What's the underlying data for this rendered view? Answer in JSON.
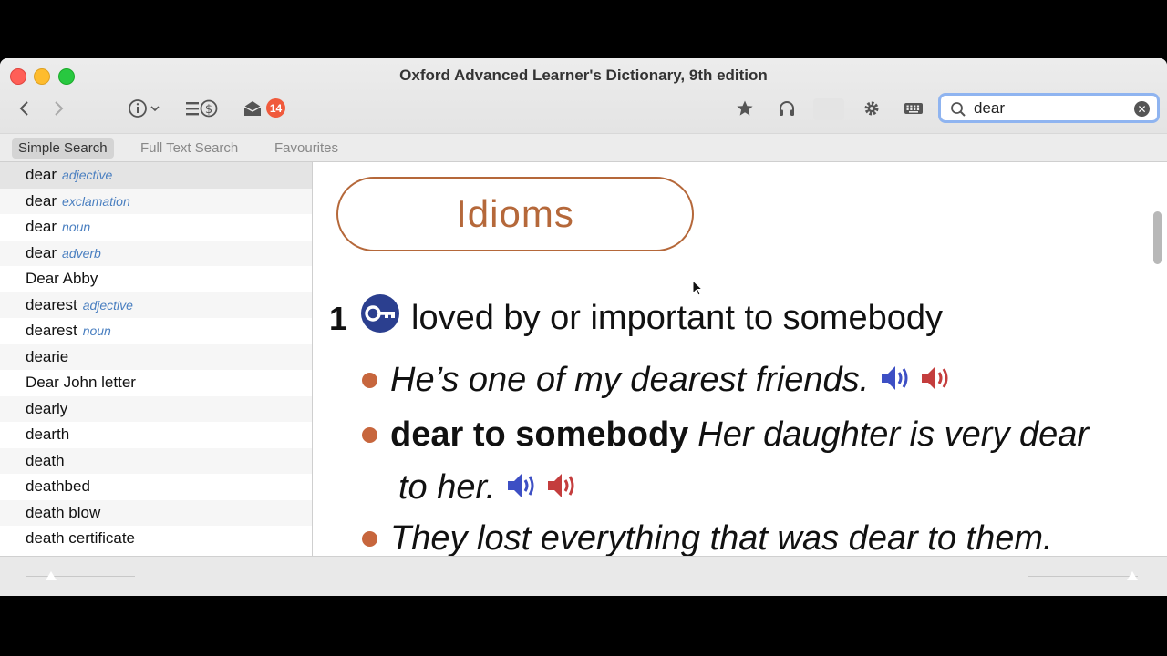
{
  "window": {
    "title": "Oxford Advanced Learner's Dictionary, 9th edition"
  },
  "toolbar": {
    "back_icon": "chevron-left-icon",
    "forward_icon": "chevron-right-icon",
    "info_icon": "info-icon",
    "list_icon": "list-dollar-icon",
    "inbox_icon": "open-envelope-icon",
    "inbox_badge": "14",
    "favorite_icon": "star-icon",
    "audio_icon": "headphones-icon",
    "settings_icon": "gear-icon",
    "keyboard_icon": "keyboard-icon"
  },
  "search": {
    "value": "dear",
    "placeholder": ""
  },
  "scope_tabs": [
    {
      "label": "Simple Search",
      "active": true
    },
    {
      "label": "Full Text Search",
      "active": false
    },
    {
      "label": "Favourites",
      "active": false
    }
  ],
  "results": [
    {
      "word": "dear",
      "pos": "adjective"
    },
    {
      "word": "dear",
      "pos": "exclamation"
    },
    {
      "word": "dear",
      "pos": "noun"
    },
    {
      "word": "dear",
      "pos": "adverb"
    },
    {
      "word": "Dear Abby",
      "pos": ""
    },
    {
      "word": "dearest",
      "pos": "adjective"
    },
    {
      "word": "dearest",
      "pos": "noun"
    },
    {
      "word": "dearie",
      "pos": ""
    },
    {
      "word": "Dear John letter",
      "pos": ""
    },
    {
      "word": "dearly",
      "pos": ""
    },
    {
      "word": "dearth",
      "pos": ""
    },
    {
      "word": "death",
      "pos": ""
    },
    {
      "word": "deathbed",
      "pos": ""
    },
    {
      "word": "death blow",
      "pos": ""
    },
    {
      "word": "death certificate",
      "pos": ""
    }
  ],
  "entry": {
    "section_label": "Idioms",
    "sense_number": "1",
    "sense_definition": "loved by or important to somebody",
    "examples": [
      {
        "bold": "",
        "text": "He’s one of my dearest friends."
      },
      {
        "bold": "dear to somebody",
        "text": "Her daughter is very dear",
        "text_cont": "to her."
      },
      {
        "bold": "",
        "text": "They lost everything that was dear to them."
      }
    ]
  },
  "colors": {
    "accent_brown": "#b5683a",
    "bullet_orange": "#c7663d",
    "pos_blue": "#4a7fc0",
    "speaker_uk": "#3d4fc4",
    "speaker_us": "#c43d3d",
    "badge_red": "#f05a3c"
  }
}
